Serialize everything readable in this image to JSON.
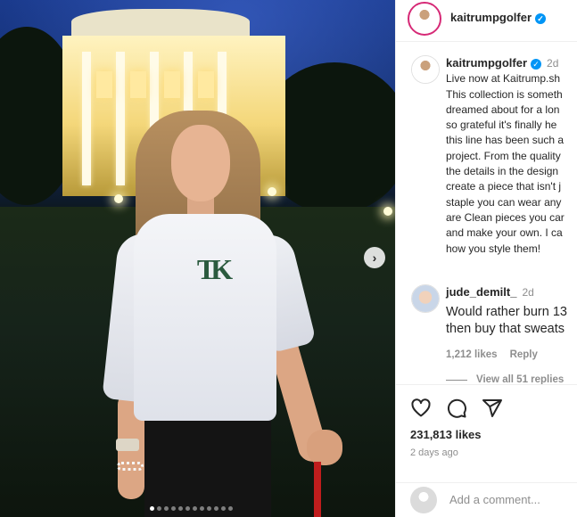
{
  "header": {
    "username": "kaitrumpgolfer",
    "verified_icon": "verified-badge-icon"
  },
  "photo": {
    "sweater_logo": "TK",
    "carousel": {
      "total": 12,
      "current": 1
    },
    "next_icon": "chevron-right-icon"
  },
  "caption": {
    "username": "kaitrumpgolfer",
    "time": "2d",
    "text": "Live now at Kaitrump.sh\nThis collection is someth\ndreamed about for a lon\nso grateful it's finally he\nthis line has been such a\nproject. From the quality\nthe details in the design\ncreate a piece that isn't j\nstaple you can wear any\nare Clean pieces you car\nand make your own. I ca\nhow you style them!"
  },
  "comment": {
    "username": "jude_demilt_",
    "time": "2d",
    "text": "Would rather burn 13\nthen buy that sweats",
    "likes": "1,212 likes",
    "reply_label": "Reply",
    "view_replies": "View all 51 replies"
  },
  "actions": {
    "icons": [
      "heart-icon",
      "comment-icon",
      "share-icon"
    ],
    "likes": "231,813 likes",
    "posted": "2 days ago"
  },
  "add_comment": {
    "placeholder": "Add a comment..."
  },
  "colors": {
    "text": "#262626",
    "muted": "#8e8e8e",
    "verified": "#0095f6",
    "border": "#efefef"
  }
}
